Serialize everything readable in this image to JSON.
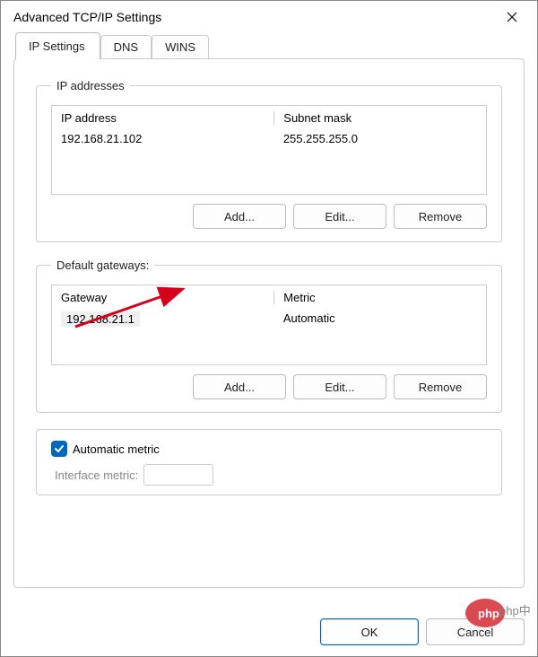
{
  "title": "Advanced TCP/IP Settings",
  "tabs": {
    "ip_settings": "IP Settings",
    "dns": "DNS",
    "wins": "WINS"
  },
  "ip_group": {
    "legend": "IP addresses",
    "header_ip": "IP address",
    "header_mask": "Subnet mask",
    "row_ip": "192.168.21.102",
    "row_mask": "255.255.255.0",
    "add": "Add...",
    "edit": "Edit...",
    "remove": "Remove"
  },
  "gw_group": {
    "legend": "Default gateways:",
    "header_gw": "Gateway",
    "header_metric": "Metric",
    "row_gw": "192.168.21.1",
    "row_metric": "Automatic",
    "add": "Add...",
    "edit": "Edit...",
    "remove": "Remove"
  },
  "auto_metric": "Automatic metric",
  "interface_metric_label": "Interface metric:",
  "buttons": {
    "ok": "OK",
    "cancel": "Cancel"
  },
  "watermark": "php中文网"
}
